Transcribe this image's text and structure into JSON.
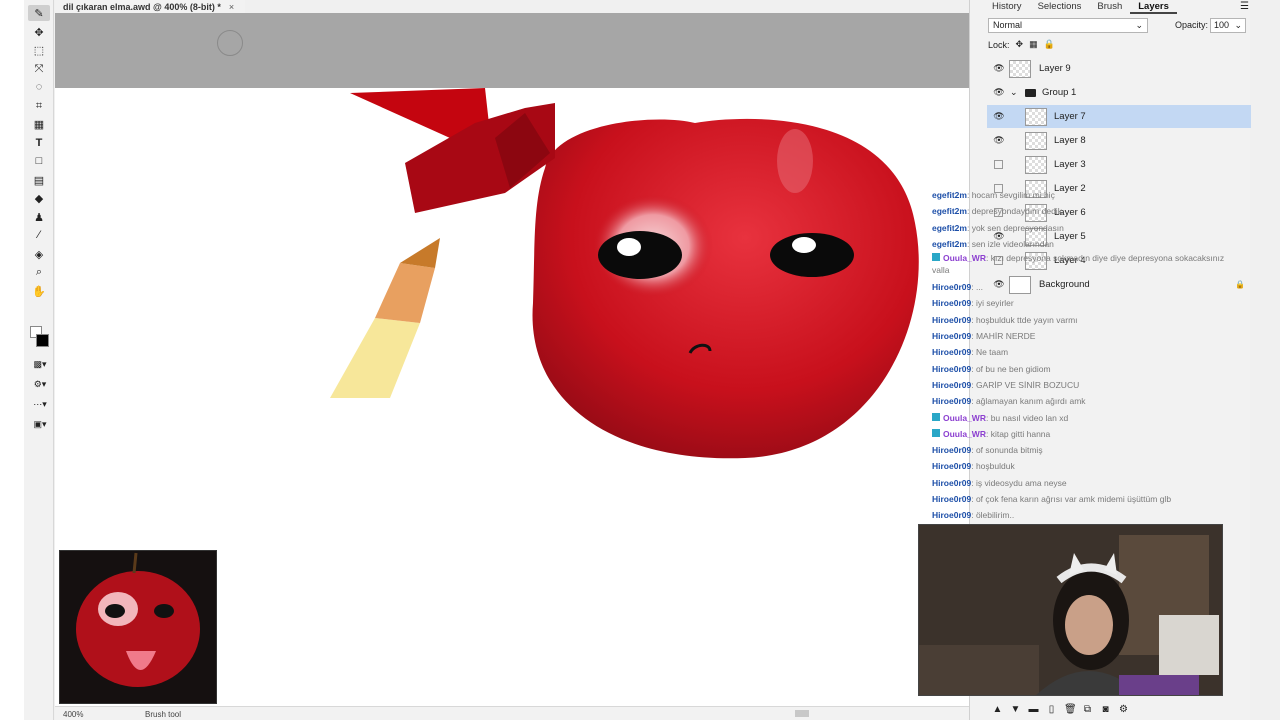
{
  "document": {
    "tab_title": "dil çıkaran elma.awd @ 400% (8-bit) *",
    "close_glyph": "×"
  },
  "toolbar": {
    "tools": [
      "brush-tool",
      "move-tool",
      "rect-select-tool",
      "magic-wand-tool",
      "lasso-tool",
      "crop-tool",
      "grid-tool",
      "text-tool",
      "shape-tool",
      "gradient-tool",
      "eraser-tool",
      "clone-stamp-tool",
      "eyedropper-tool",
      "fill-tool",
      "zoom-tool",
      "hand-tool"
    ]
  },
  "status": {
    "zoom": "400%",
    "tool": "Brush tool"
  },
  "panel": {
    "tabs": [
      "History",
      "Selections",
      "Brush",
      "Layers"
    ],
    "active_tab": "Layers",
    "blend_mode": "Normal",
    "opacity_label": "Opacity:",
    "opacity_value": "100",
    "lock_label": "Lock:",
    "layers": [
      {
        "name": "Layer 9",
        "visible": true
      },
      {
        "name": "Group 1",
        "visible": true,
        "group": true
      },
      {
        "name": "Layer 7",
        "visible": true,
        "selected": true
      },
      {
        "name": "Layer 8",
        "visible": true
      },
      {
        "name": "Layer 3",
        "visible": false
      },
      {
        "name": "Layer 2",
        "visible": false
      },
      {
        "name": "Layer 6",
        "visible": false
      },
      {
        "name": "Layer 5",
        "visible": true
      },
      {
        "name": "Layer 4",
        "visible": false
      },
      {
        "name": "Background",
        "visible": true,
        "locked": true
      }
    ]
  },
  "chat": [
    {
      "user": "egefit2m",
      "text": ": hocam sevgilim mi hiç",
      "color": "blue"
    },
    {
      "user": "egefit2m",
      "text": ": depresyondaydım dedik",
      "color": "blue"
    },
    {
      "user": "egefit2m",
      "text": ": yok sen depresyondasın",
      "color": "blue"
    },
    {
      "user": "egefit2m",
      "text": ": sen izle videolarından",
      "color": "blue"
    },
    {
      "user": "Ouula_WR",
      "text": ": kızı depresyona sokmadın diye diye depresyona sokacaksınız valla",
      "color": "purple",
      "badge": true
    },
    {
      "user": "Hiroe0r09",
      "text": ": ...",
      "color": "blue"
    },
    {
      "user": "Hiroe0r09",
      "text": ": iyi seyirler",
      "color": "blue"
    },
    {
      "user": "Hiroe0r09",
      "text": ": hoşbulduk ttde yayın varmı",
      "color": "blue"
    },
    {
      "user": "Hiroe0r09",
      "text": ": MAHİR NERDE",
      "color": "blue"
    },
    {
      "user": "Hiroe0r09",
      "text": ": Ne taam",
      "color": "blue"
    },
    {
      "user": "Hiroe0r09",
      "text": ": of bu ne ben gidiom",
      "color": "blue"
    },
    {
      "user": "Hiroe0r09",
      "text": ": GARİP VE SİNİR BOZUCU",
      "color": "blue"
    },
    {
      "user": "Hiroe0r09",
      "text": ": ağlamayan kanım ağırdı amk",
      "color": "blue"
    },
    {
      "user": "Ouula_WR",
      "text": ": bu nasıl video lan xd",
      "color": "purple",
      "badge": true
    },
    {
      "user": "Ouula_WR",
      "text": ": kitap gitti hanna",
      "color": "purple",
      "badge": true
    },
    {
      "user": "Hiroe0r09",
      "text": ": of sonunda bitmiş",
      "color": "blue"
    },
    {
      "user": "Hiroe0r09",
      "text": ": hoşbulduk",
      "color": "blue"
    },
    {
      "user": "Hiroe0r09",
      "text": ": iş videosydu ama neyse",
      "color": "blue"
    },
    {
      "user": "Hiroe0r09",
      "text": ": of çok fena karın ağrısı var amk midemi üşüttüm glb",
      "color": "blue"
    },
    {
      "user": "Hiroe0r09",
      "text": ": ölebilirim..",
      "color": "blue"
    }
  ],
  "colors": {
    "apple_red": "#c8101c",
    "selection_blue": "#c3d8f3",
    "pasteboard": "#a6a6a6",
    "pencil_orange": "#e8a060",
    "pencil_yellow": "#f7e79a"
  }
}
